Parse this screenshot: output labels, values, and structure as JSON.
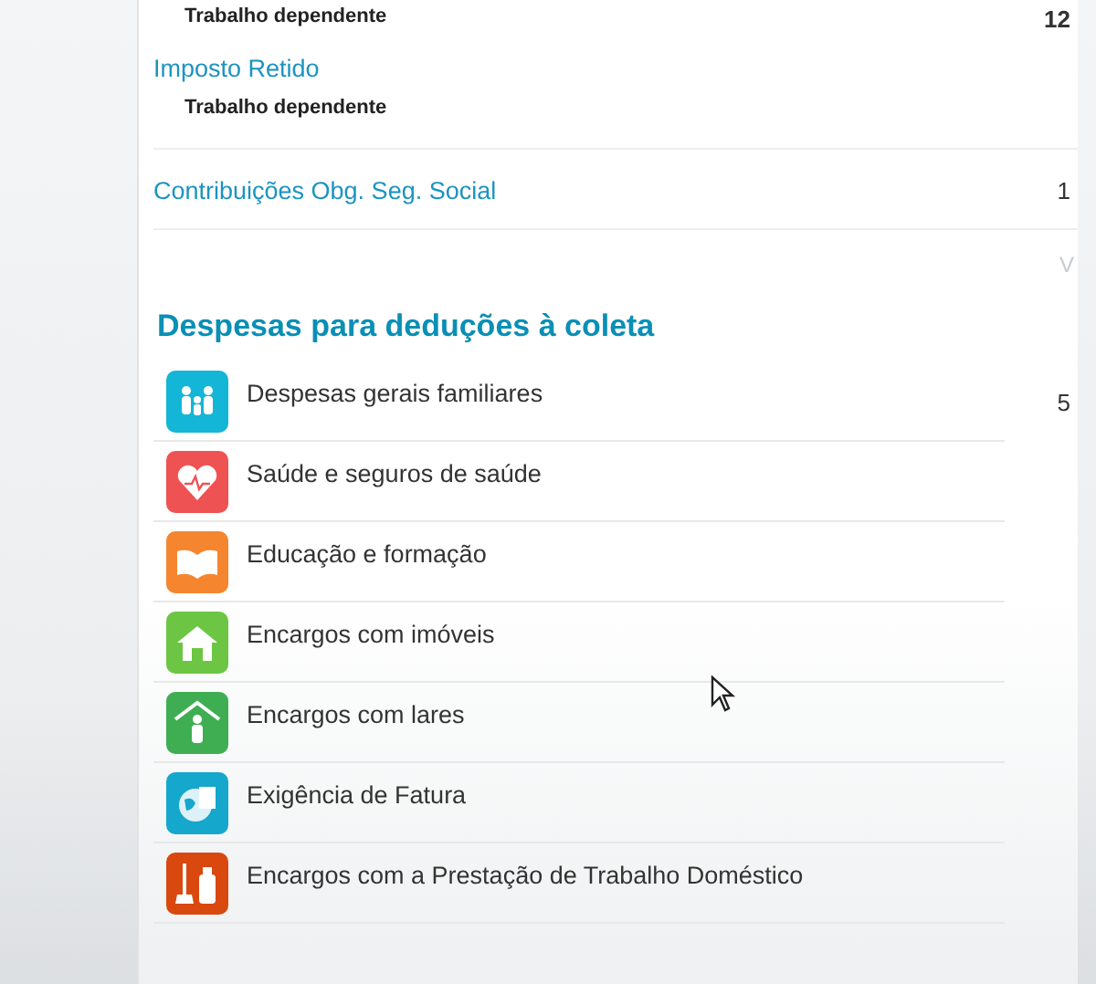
{
  "income_rows": [
    {
      "kind": "sub",
      "label": "Trabalho dependente",
      "value": "12"
    },
    {
      "kind": "link",
      "label": "Imposto Retido"
    },
    {
      "kind": "sub",
      "label": "Trabalho dependente"
    },
    {
      "kind": "link",
      "label": "Contribuições Obg. Seg. Social",
      "value": "1"
    }
  ],
  "edge_text": "V",
  "deductions": {
    "title": "Despesas para deduções à coleta",
    "items": [
      {
        "kind": "family",
        "label": "Despesas gerais familiares",
        "value": "5",
        "color": "#13b6d6"
      },
      {
        "kind": "health",
        "label": "Saúde e seguros de saúde",
        "color": "#ef5253"
      },
      {
        "kind": "education",
        "label": "Educação e formação",
        "color": "#f5862f"
      },
      {
        "kind": "property",
        "label": "Encargos com imóveis",
        "color": "#6cc644"
      },
      {
        "kind": "care_home",
        "label": "Encargos com lares",
        "color": "#3fae52"
      },
      {
        "kind": "invoice",
        "label": "Exigência de Fatura",
        "color": "#15a7cc"
      },
      {
        "kind": "domestic",
        "label": "Encargos com a Prestação de Trabalho Doméstico",
        "color": "#d9480f"
      }
    ]
  }
}
